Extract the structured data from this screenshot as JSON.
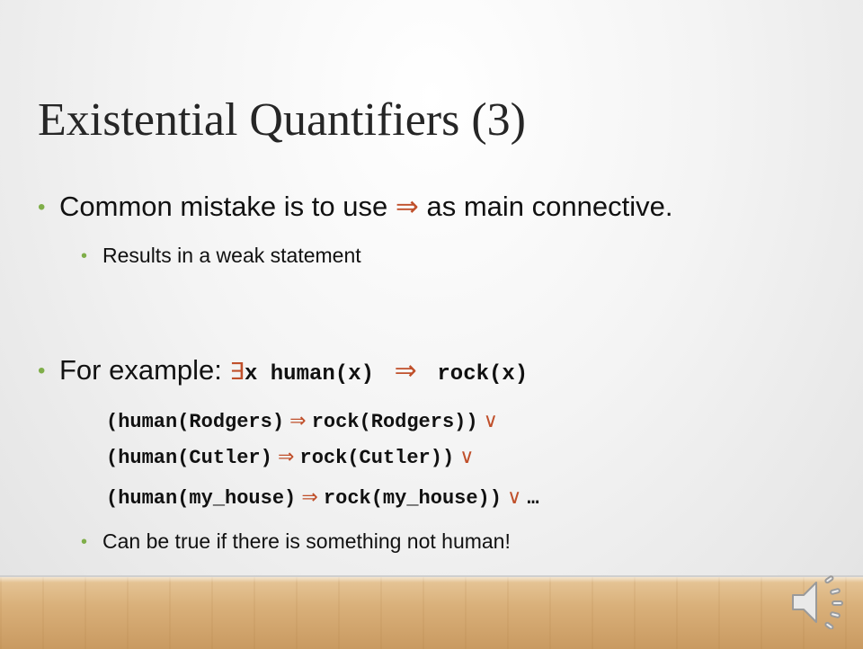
{
  "slide": {
    "title": "Existential Quantifiers (3)",
    "bullet1": {
      "pre": "Common mistake is to use",
      "arrow": "⇒",
      "post": "as main connective."
    },
    "sub1": "Results in a weak statement",
    "bullet2": {
      "label": "For example:",
      "exists": "∃",
      "formula_a": "x human(x)",
      "arrow": "⇒",
      "formula_b": "rock(x)"
    },
    "examples": [
      {
        "lhs": "(human(Rodgers)",
        "arrow": "⇒",
        "rhs": "rock(Rodgers))",
        "or": "∨",
        "tail": ""
      },
      {
        "lhs": "(human(Cutler)",
        "arrow": "⇒",
        "rhs": "rock(Cutler))",
        "or": "∨",
        "tail": ""
      },
      {
        "lhs": "(human(my_house)",
        "arrow": "⇒",
        "rhs": "rock(my_house))",
        "or": "∨",
        "tail": "…"
      }
    ],
    "sub2": "Can be true if there is something not human!"
  },
  "colors": {
    "bullet": "#7fae49",
    "arrow": "#c0502b",
    "title": "#262626"
  },
  "icons": {
    "audio": "speaker-icon"
  }
}
